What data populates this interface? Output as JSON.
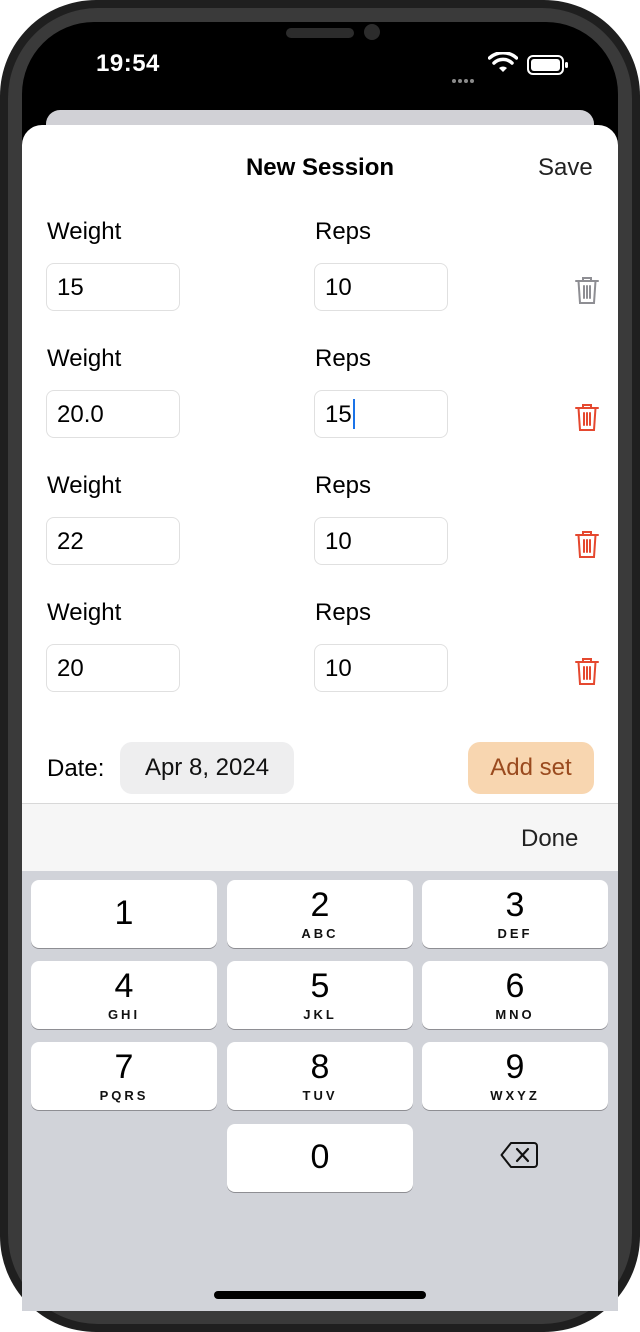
{
  "status_bar": {
    "time": "19:54"
  },
  "header": {
    "title": "New Session",
    "save_label": "Save"
  },
  "sets": [
    {
      "weight_label": "Weight",
      "reps_label": "Reps",
      "weight": "15",
      "reps": "10",
      "delete_enabled": false
    },
    {
      "weight_label": "Weight",
      "reps_label": "Reps",
      "weight": "20.0",
      "reps": "15",
      "delete_enabled": true
    },
    {
      "weight_label": "Weight",
      "reps_label": "Reps",
      "weight": "22",
      "reps": "10",
      "delete_enabled": true
    },
    {
      "weight_label": "Weight",
      "reps_label": "Reps",
      "weight": "20",
      "reps": "10",
      "delete_enabled": true
    }
  ],
  "footer": {
    "date_label": "Date:",
    "date_value": "Apr 8, 2024",
    "add_set_label": "Add set"
  },
  "keyboard": {
    "done_label": "Done",
    "keys": [
      {
        "num": "1",
        "letters": ""
      },
      {
        "num": "2",
        "letters": "ABC"
      },
      {
        "num": "3",
        "letters": "DEF"
      },
      {
        "num": "4",
        "letters": "GHI"
      },
      {
        "num": "5",
        "letters": "JKL"
      },
      {
        "num": "6",
        "letters": "MNO"
      },
      {
        "num": "7",
        "letters": "PQRS"
      },
      {
        "num": "8",
        "letters": "TUV"
      },
      {
        "num": "9",
        "letters": "WXYZ"
      },
      {
        "num": "0",
        "letters": ""
      }
    ]
  },
  "colors": {
    "trash_disabled": "#8e8e93",
    "trash_enabled": "#e5482f",
    "add_set_bg": "#f8d6b0",
    "add_set_text": "#9a4a1e",
    "caret": "#1a73e8"
  }
}
